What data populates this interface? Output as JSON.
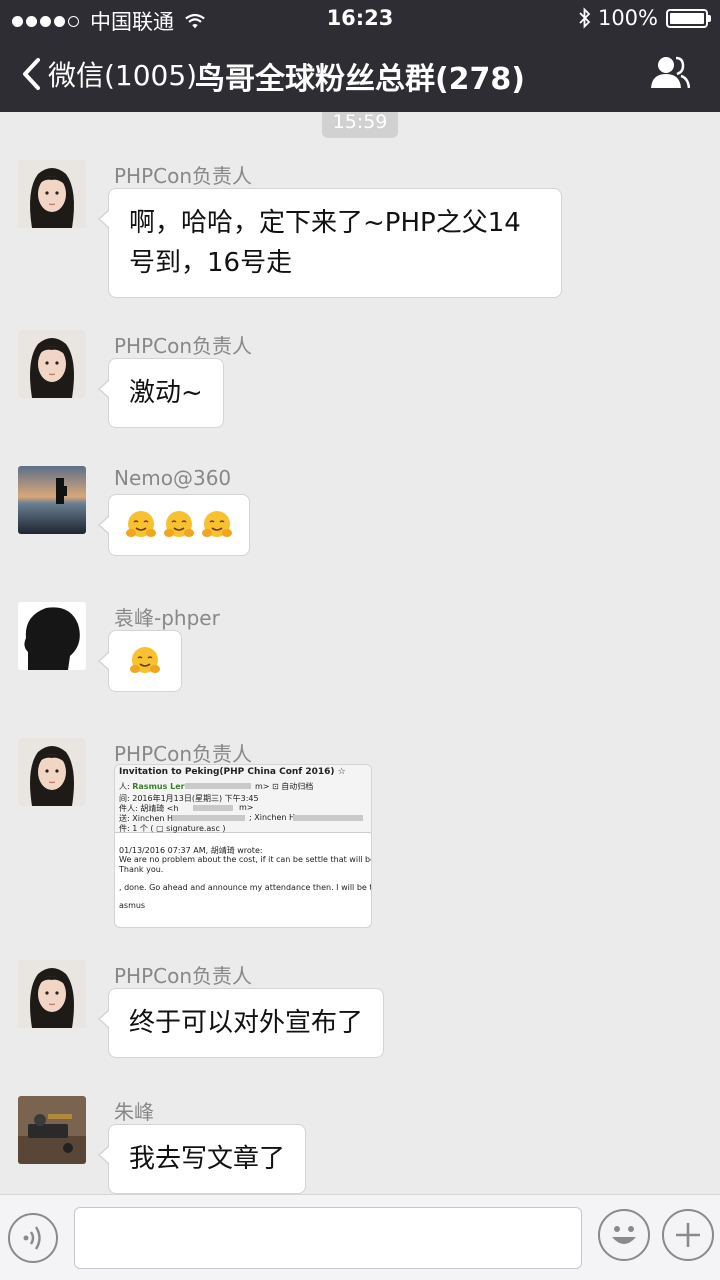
{
  "status_bar": {
    "carrier": "中国联通",
    "time": "16:23",
    "battery_text": "100%"
  },
  "nav": {
    "back_label": "微信(1005)",
    "title": "鸟哥全球粉丝总群(278)"
  },
  "timestamp": "15:59",
  "messages": [
    {
      "sender": "PHPCon负责人",
      "text": "啊，哈哈，定下来了~PHP之父14号到，16号走",
      "avatar": "woman-portrait"
    },
    {
      "sender": "PHPCon负责人",
      "text": "激动~",
      "avatar": "woman-portrait"
    },
    {
      "sender": "Nemo@360",
      "emoji_count": 3,
      "emoji": "hugging-face-emoji",
      "avatar": "lake-sunset"
    },
    {
      "sender": "袁峰-phper",
      "emoji_count": 1,
      "emoji": "hugging-face-emoji",
      "avatar": "head-silhouette"
    },
    {
      "sender": "PHPCon负责人",
      "avatar": "woman-portrait",
      "image": {
        "subject": "Invitation to Peking(PHP China Conf 2016) ☆",
        "from_prefix": "人:",
        "from_name": "Rasmus Lerdorf",
        "from_suffix": "m> ⊡ 自动归档",
        "date_line": "间: 2016年1月13日(星期三) 下午3:45",
        "to_line": "件人: 胡靖琦 <h",
        "to_suffix": "m>",
        "cc_line": "送: Xinchen Hu",
        "cc_suffix": "; Xinchen Hu",
        "attach_line": "件: 1 个 ( ▢ signature.asc )",
        "quote_header": "01/13/2016 07:37 AM, 胡靖琦 wrote:",
        "quote_line1": "We are no problem about the cost, if it can be settle that will be glad.",
        "quote_line2": "Thank you.",
        "reply_line": ", done. Go ahead and announce my attendance then. I will be there.",
        "signature": "asmus"
      }
    },
    {
      "sender": "PHPCon负责人",
      "text": "终于可以对外宣布了",
      "avatar": "woman-portrait"
    },
    {
      "sender": "朱峰",
      "text": "我去写文章了",
      "avatar": "desk-photo"
    }
  ]
}
